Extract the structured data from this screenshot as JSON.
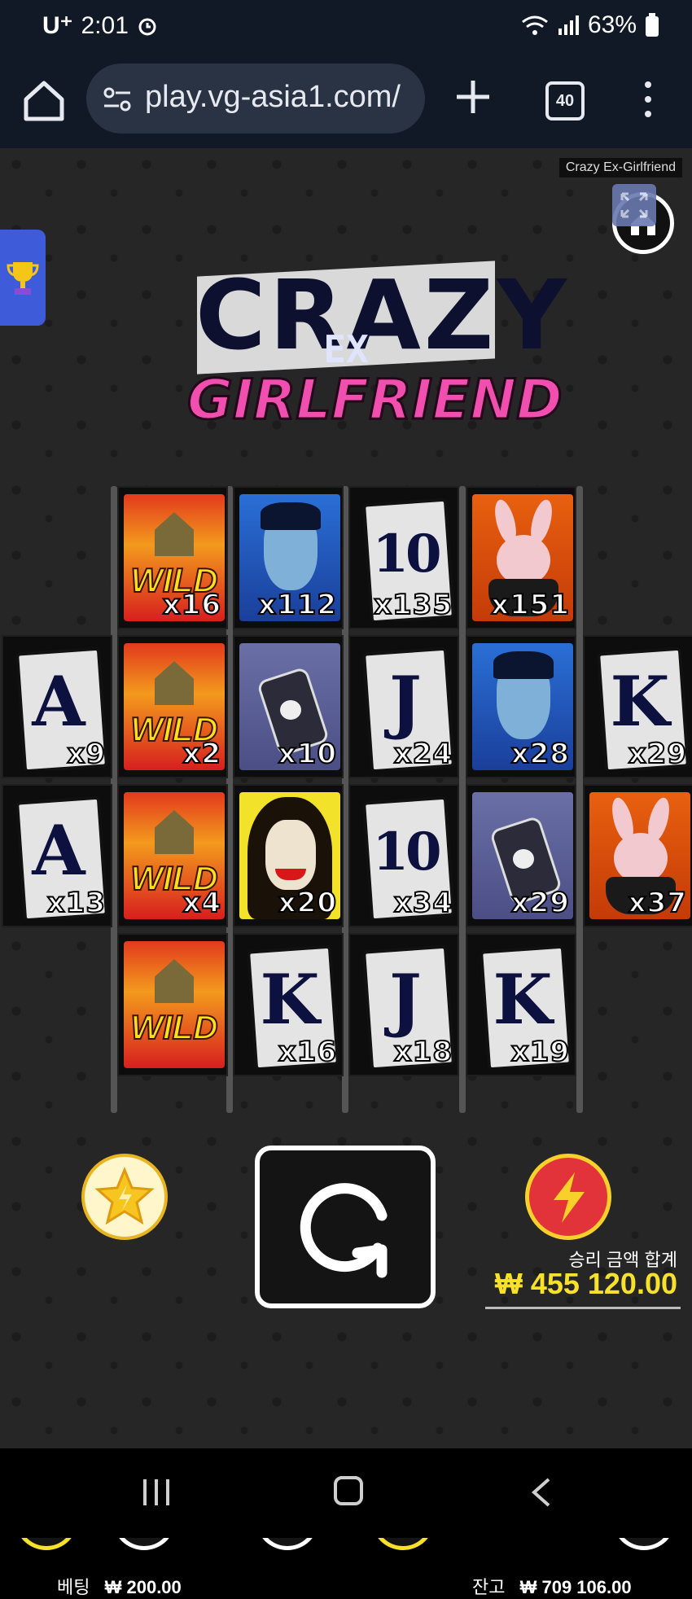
{
  "status_bar": {
    "carrier": "U⁺",
    "time": "2:01",
    "battery": "63%"
  },
  "browser": {
    "url": "play.vg-asia1.com/",
    "tab_count": "40"
  },
  "game": {
    "label": "Crazy Ex-Girlfriend",
    "logo": {
      "line1": "CRAZY",
      "line2": "EX",
      "line3": "GIRLFRIEND"
    },
    "reels": [
      {
        "col": 0,
        "row": 1,
        "symbol": "A",
        "type": "card",
        "mult": "x9"
      },
      {
        "col": 0,
        "row": 2,
        "symbol": "A",
        "type": "card",
        "mult": "x13"
      },
      {
        "col": 1,
        "row": 0,
        "symbol": "WILD",
        "type": "wild",
        "mult": "x16"
      },
      {
        "col": 1,
        "row": 1,
        "symbol": "WILD",
        "type": "wild",
        "mult": "x2"
      },
      {
        "col": 1,
        "row": 2,
        "symbol": "WILD",
        "type": "wild",
        "mult": "x4"
      },
      {
        "col": 1,
        "row": 3,
        "symbol": "WILD",
        "type": "wild",
        "mult": ""
      },
      {
        "col": 2,
        "row": 0,
        "symbol": "scared-man",
        "type": "face-blue",
        "mult": "x112"
      },
      {
        "col": 2,
        "row": 1,
        "symbol": "poison",
        "type": "potion",
        "mult": "x10"
      },
      {
        "col": 2,
        "row": 2,
        "symbol": "girl",
        "type": "girl",
        "mult": "x20"
      },
      {
        "col": 2,
        "row": 3,
        "symbol": "K",
        "type": "card",
        "mult": "x16"
      },
      {
        "col": 3,
        "row": 0,
        "symbol": "10",
        "type": "card",
        "mult": "x135"
      },
      {
        "col": 3,
        "row": 1,
        "symbol": "J",
        "type": "card",
        "mult": "x24"
      },
      {
        "col": 3,
        "row": 2,
        "symbol": "10",
        "type": "card",
        "mult": "x34"
      },
      {
        "col": 3,
        "row": 3,
        "symbol": "J",
        "type": "card",
        "mult": "x18"
      },
      {
        "col": 4,
        "row": 0,
        "symbol": "bunny",
        "type": "bunny",
        "mult": "x151"
      },
      {
        "col": 4,
        "row": 1,
        "symbol": "scared-man",
        "type": "face-blue",
        "mult": "x28"
      },
      {
        "col": 4,
        "row": 2,
        "symbol": "poison",
        "type": "potion",
        "mult": "x29"
      },
      {
        "col": 4,
        "row": 3,
        "symbol": "K",
        "type": "card",
        "mult": "x19"
      },
      {
        "col": 5,
        "row": 1,
        "symbol": "K",
        "type": "card",
        "mult": "x29"
      },
      {
        "col": 5,
        "row": 2,
        "symbol": "bunny",
        "type": "bunny",
        "mult": "x37"
      }
    ],
    "win_label": "승리 금액 합계",
    "win_value": "₩ 455 120.00",
    "bet_label": "베팅",
    "bet_value": "₩ 200.00",
    "balance_label": "잔고",
    "balance_value": "₩ 709 106.00"
  },
  "colors": {
    "accent_yellow": "#f7e12a",
    "bolt_red": "#e2333a",
    "logo_pink": "#f04fb0"
  }
}
